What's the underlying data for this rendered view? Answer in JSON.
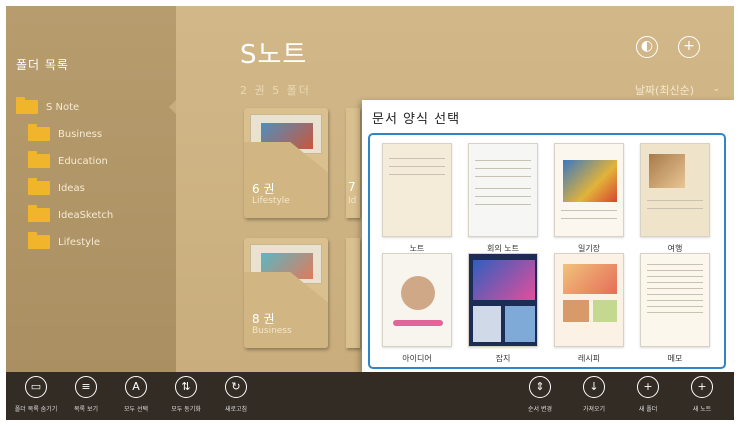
{
  "sidebar": {
    "title": "폴더 목록",
    "folders": [
      {
        "label": "S Note"
      },
      {
        "label": "Business"
      },
      {
        "label": "Education"
      },
      {
        "label": "Ideas"
      },
      {
        "label": "IdeaSketch"
      },
      {
        "label": "Lifestyle"
      }
    ]
  },
  "main": {
    "title": "S노트",
    "subtitle": "2 권 5 폴더",
    "sort_label": "날짜(최신순)",
    "sort_chevron": "⌄",
    "notebooks": [
      {
        "count": "6 권",
        "category": "Lifestyle"
      },
      {
        "count": "7",
        "category": "Id"
      },
      {
        "count": "8 권",
        "category": "Business"
      }
    ]
  },
  "dialog": {
    "title": "문서 양식 선택",
    "templates": [
      {
        "label": "노트"
      },
      {
        "label": "회의 노트"
      },
      {
        "label": "일기장"
      },
      {
        "label": "여행"
      },
      {
        "label": "아이디어"
      },
      {
        "label": "잡지"
      },
      {
        "label": "레시피"
      },
      {
        "label": "메모"
      }
    ]
  },
  "appbar": {
    "left": [
      {
        "label": "폴더 목록 숨기기",
        "icon": "folder-list-icon",
        "glyph": "▭"
      },
      {
        "label": "목록 보기",
        "icon": "list-view-icon",
        "glyph": "≡"
      },
      {
        "label": "모두 선택",
        "icon": "select-all-icon",
        "glyph": "A"
      },
      {
        "label": "모두 동기화",
        "icon": "sync-icon",
        "glyph": "⇅"
      },
      {
        "label": "새로고침",
        "icon": "refresh-icon",
        "glyph": "↻"
      }
    ],
    "right": [
      {
        "label": "순서 변경",
        "icon": "reorder-icon",
        "glyph": "⇕"
      },
      {
        "label": "가져오기",
        "icon": "import-icon",
        "glyph": "↓"
      },
      {
        "label": "새 폴더",
        "icon": "new-folder-icon",
        "glyph": "+"
      },
      {
        "label": "새 노트",
        "icon": "new-note-icon",
        "glyph": "+"
      }
    ]
  },
  "colors": {
    "accent": "#2c86c9",
    "folder": "#f1b52b",
    "appbar": "#332c24"
  }
}
